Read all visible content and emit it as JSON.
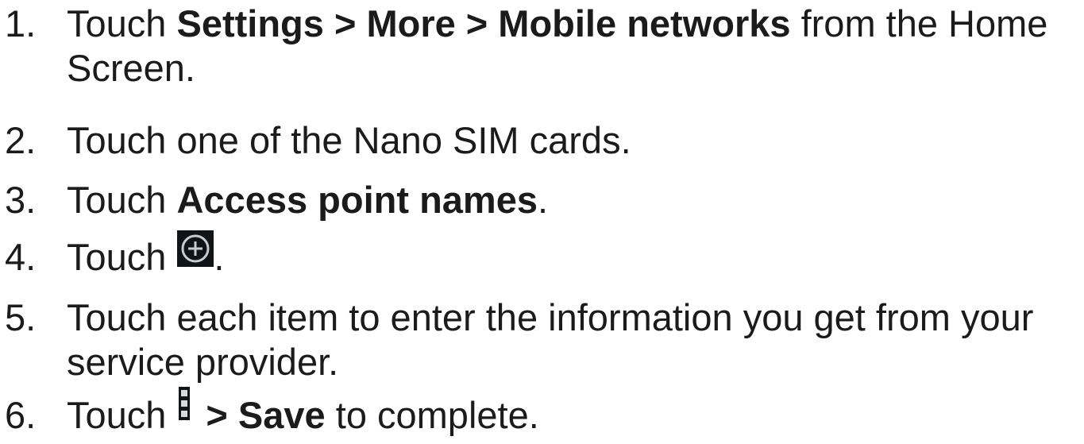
{
  "steps": [
    {
      "num": "1.",
      "pre": "Touch ",
      "bold": "Settings > More > Mobile networks",
      "post": " from the Home",
      "line2": "Screen."
    },
    {
      "num": "2.",
      "text": "Touch one of the Nano SIM cards."
    },
    {
      "num": "3.",
      "pre": "Touch ",
      "bold": "Access point names",
      "post": "."
    },
    {
      "num": "4.",
      "pre": "Touch",
      "icon": "add-circle-icon",
      "post": "."
    },
    {
      "num": "5.",
      "text": "Touch each item to enter the information you get from your",
      "line2": "service provider."
    },
    {
      "num": "6.",
      "pre": "Touch",
      "icon": "overflow-menu-icon",
      "bold": "> Save",
      "post": " to complete."
    }
  ]
}
